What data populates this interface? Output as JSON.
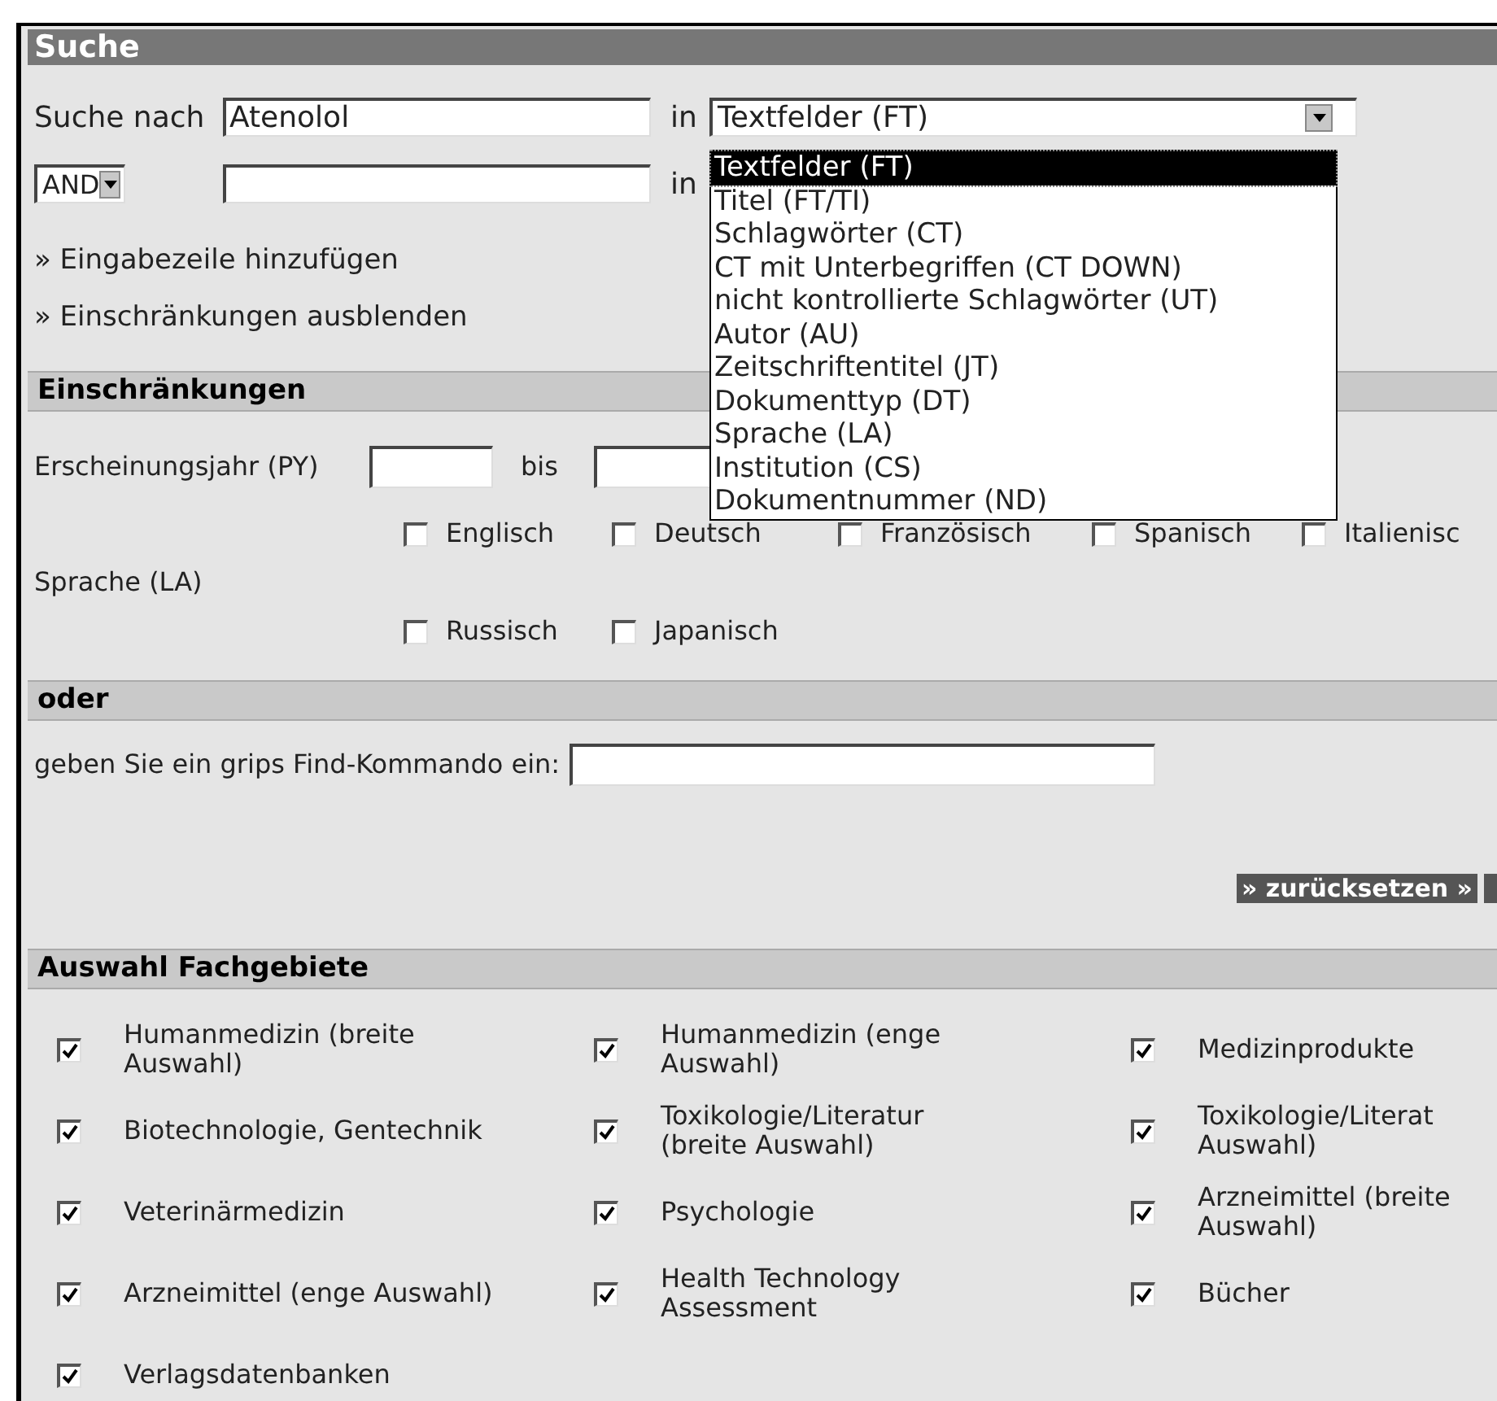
{
  "title": "Suche",
  "search": {
    "label": "Suche nach",
    "value": "Atenolol",
    "in_label": "in",
    "field": "Textfelder (FT)",
    "expanded": true,
    "options": [
      {
        "label": "Textfelder (FT)",
        "selected": true
      },
      {
        "label": "Titel (FT/TI)",
        "selected": false
      },
      {
        "label": "Schlagwörter (CT)",
        "selected": false
      },
      {
        "label": "CT mit Unterbegriffen (CT DOWN)",
        "selected": false
      },
      {
        "label": "nicht kontrollierte Schlagwörter (UT)",
        "selected": false
      },
      {
        "label": "Autor (AU)",
        "selected": false
      },
      {
        "label": "Zeitschriftentitel (JT)",
        "selected": false
      },
      {
        "label": "Dokumenttyp (DT)",
        "selected": false
      },
      {
        "label": "Sprache (LA)",
        "selected": false
      },
      {
        "label": "Institution (CS)",
        "selected": false
      },
      {
        "label": "Dokumentnummer (ND)",
        "selected": false
      }
    ]
  },
  "row2": {
    "operator": "AND",
    "in_label": "in"
  },
  "links": [
    "» Eingabezeile hinzufügen",
    "» Einschränkungen ausblenden"
  ],
  "restrictions": {
    "header": "Einschränkungen",
    "year_label": "Erscheinungsjahr (PY)",
    "to_label": "bis",
    "language_label": "Sprache (LA)",
    "languages": [
      {
        "label": "Englisch",
        "checked": false
      },
      {
        "label": "Deutsch",
        "checked": false
      },
      {
        "label": "Französisch",
        "checked": false
      },
      {
        "label": "Spanisch",
        "checked": false
      },
      {
        "label": "Italienisc",
        "checked": false
      },
      {
        "label": "Russisch",
        "checked": false
      },
      {
        "label": "Japanisch",
        "checked": false
      }
    ]
  },
  "or_section": {
    "header": "oder",
    "label": "geben Sie ein grips Find-Kommando ein:"
  },
  "reset_button": "» zurücksetzen »",
  "subjects": {
    "header": "Auswahl Fachgebiete",
    "items": [
      {
        "label": "Humanmedizin (breite\nAuswahl)",
        "checked": true
      },
      {
        "label": "Humanmedizin (enge\nAuswahl)",
        "checked": true
      },
      {
        "label": "Medizinprodukte",
        "checked": true
      },
      {
        "label": "Biotechnologie, Gentechnik",
        "checked": true
      },
      {
        "label": "Toxikologie/Literatur\n(breite Auswahl)",
        "checked": true
      },
      {
        "label": "Toxikologie/Literat\nAuswahl)",
        "checked": true
      },
      {
        "label": "Veterinärmedizin",
        "checked": true
      },
      {
        "label": "Psychologie",
        "checked": true
      },
      {
        "label": "Arzneimittel (breite\nAuswahl)",
        "checked": true
      },
      {
        "label": "Arzneimittel (enge Auswahl)",
        "checked": true
      },
      {
        "label": "Health Technology\nAssessment",
        "checked": true
      },
      {
        "label": "Bücher",
        "checked": true
      },
      {
        "label": "Verlagsdatenbanken",
        "checked": true
      }
    ]
  }
}
